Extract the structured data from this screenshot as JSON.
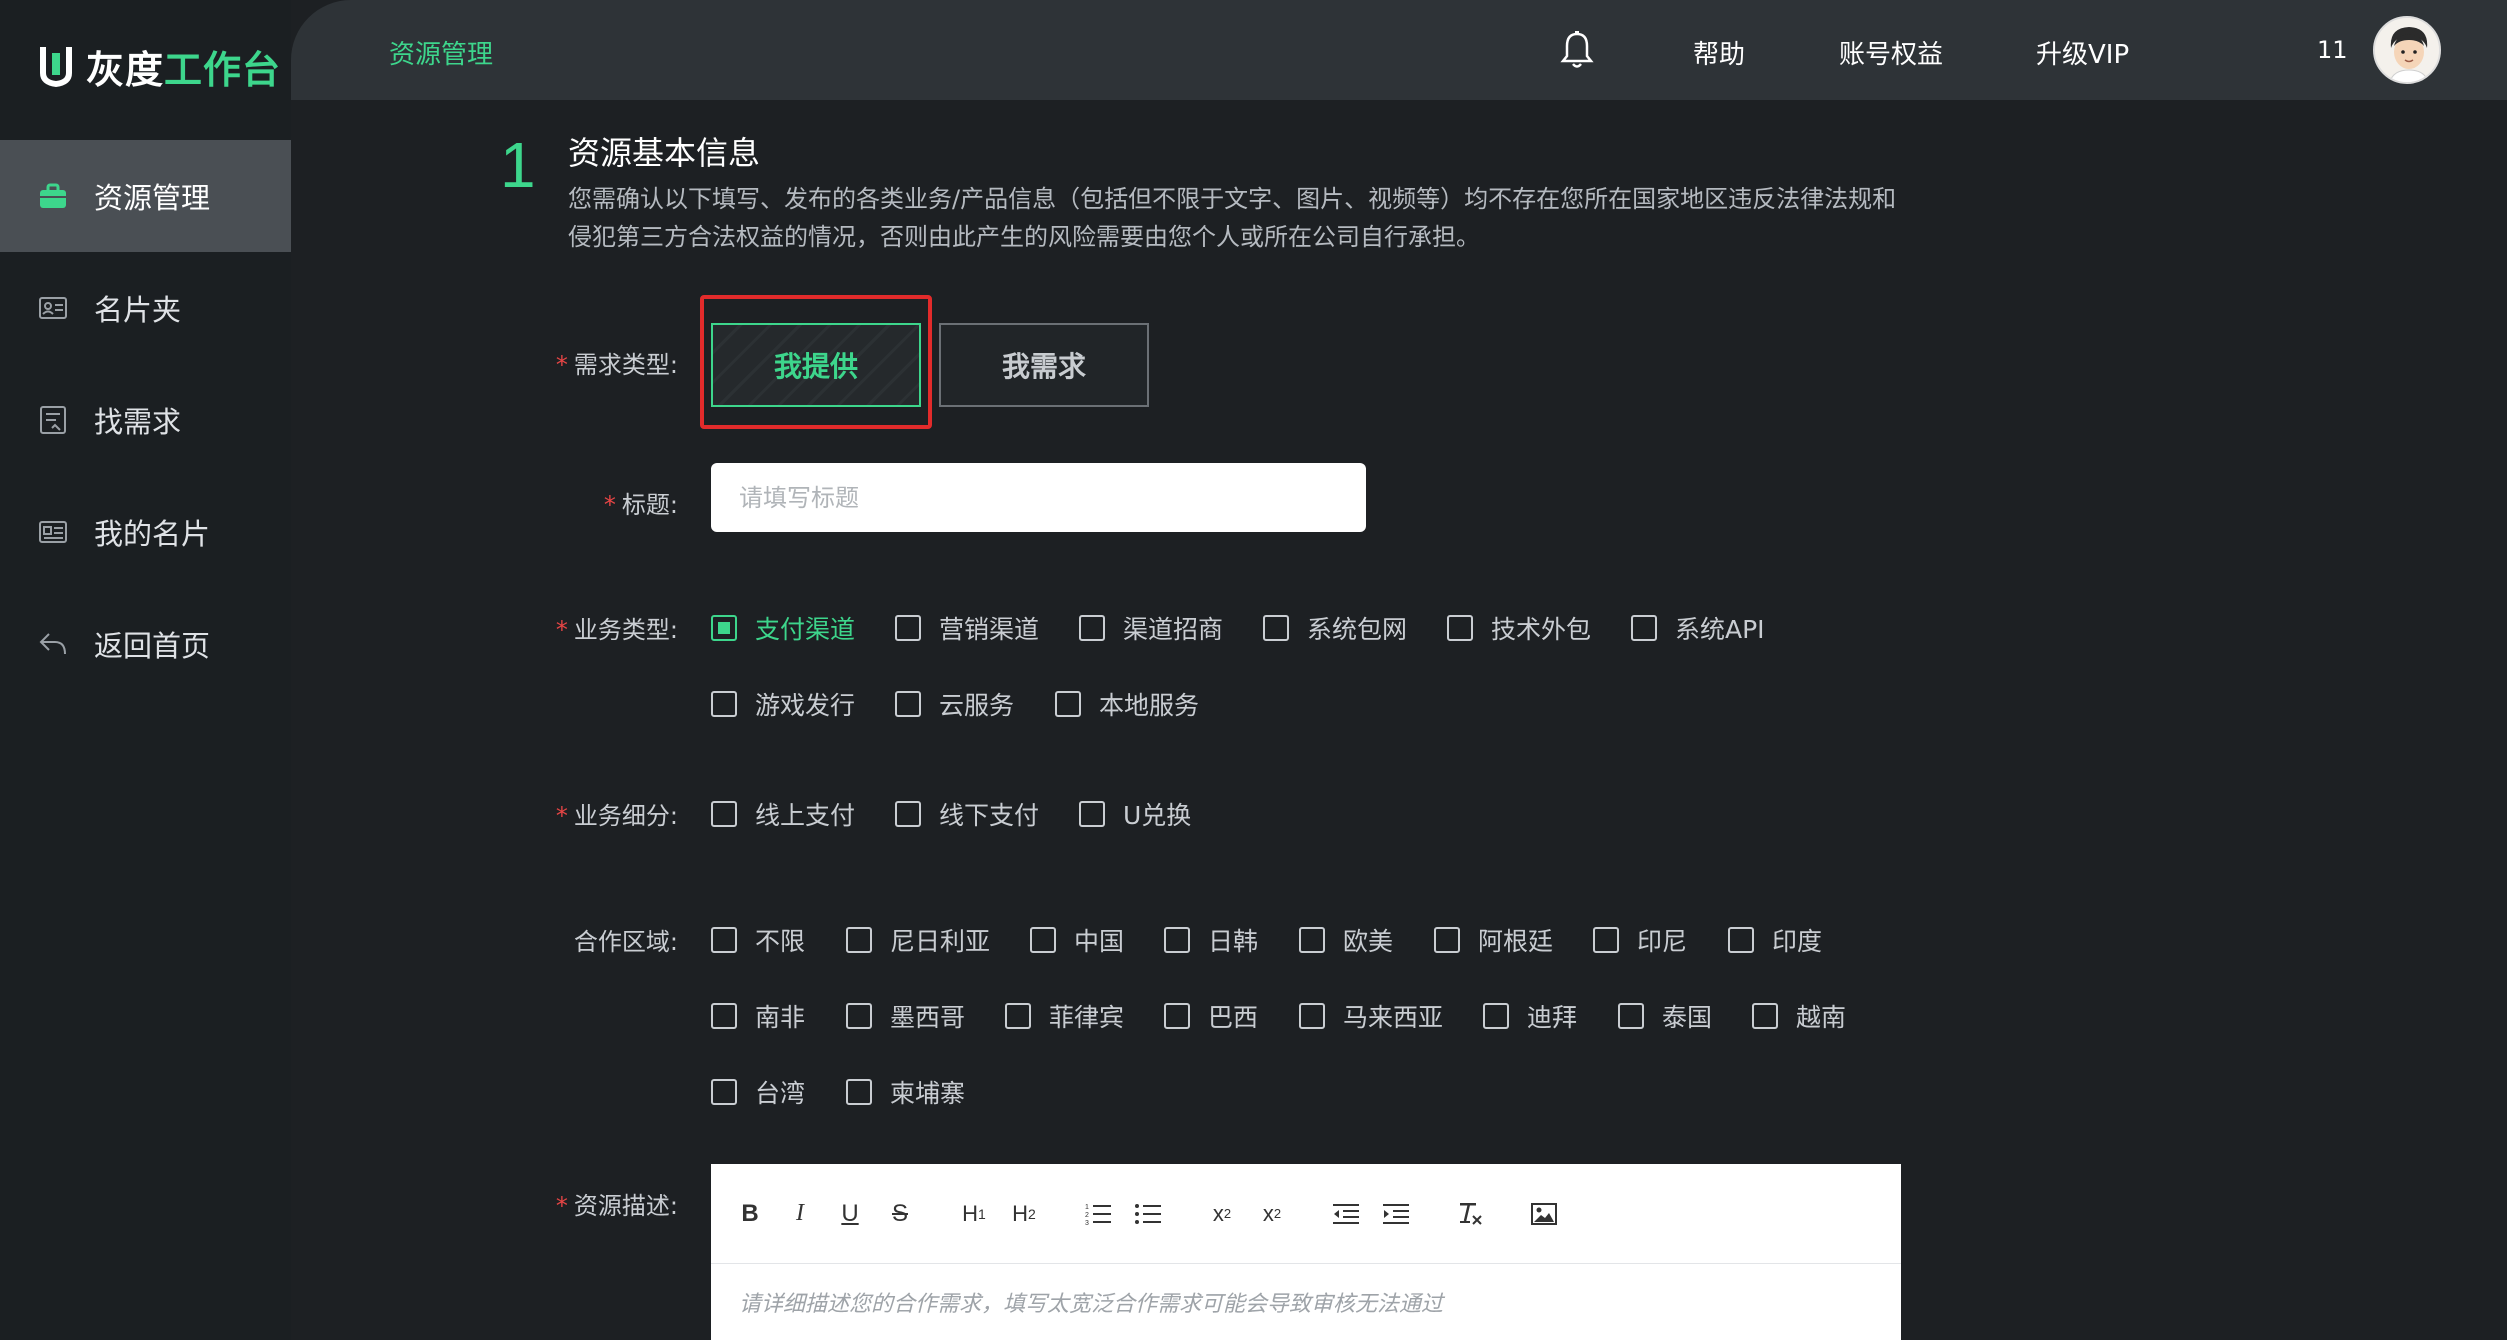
{
  "app": {
    "logo_white": "灰度",
    "logo_green": "工作台"
  },
  "sidebar": {
    "items": [
      {
        "label": "资源管理",
        "icon": "briefcase-icon",
        "active": true
      },
      {
        "label": "名片夹",
        "icon": "card-holder-icon"
      },
      {
        "label": "找需求",
        "icon": "demand-list-icon"
      },
      {
        "label": "我的名片",
        "icon": "id-card-icon"
      },
      {
        "label": "返回首页",
        "icon": "back-arrow-icon"
      }
    ]
  },
  "header": {
    "breadcrumb": "资源管理",
    "links": [
      "帮助",
      "账号权益",
      "升级VIP"
    ],
    "user_count": "11"
  },
  "section": {
    "step": "1",
    "title": "资源基本信息",
    "desc": "您需确认以下填写、发布的各类业务/产品信息（包括但不限于文字、图片、视频等）均不存在您所在国家地区违反法律法规和侵犯第三方合法权益的情况，否则由此产生的风险需要由您个人或所在公司自行承担。"
  },
  "form": {
    "demand_type_label": "需求类型:",
    "demand_types": [
      "我提供",
      "我需求"
    ],
    "demand_type_selected": "我提供",
    "title_label": "标题:",
    "title_placeholder": "请填写标题",
    "business_type_label": "业务类型:",
    "business_types": [
      "支付渠道",
      "营销渠道",
      "渠道招商",
      "系统包网",
      "技术外包",
      "系统API",
      "游戏发行",
      "云服务",
      "本地服务"
    ],
    "business_type_checked": [
      "支付渠道"
    ],
    "business_sub_label": "业务细分:",
    "business_subs": [
      "线上支付",
      "线下支付",
      "U兑换"
    ],
    "region_label": "合作区域:",
    "regions": [
      "不限",
      "尼日利亚",
      "中国",
      "日韩",
      "欧美",
      "阿根廷",
      "印尼",
      "印度",
      "南非",
      "墨西哥",
      "菲律宾",
      "巴西",
      "马来西亚",
      "迪拜",
      "泰国",
      "越南",
      "台湾",
      "柬埔寨"
    ],
    "desc_label": "资源描述:",
    "desc_placeholder": "请详细描述您的合作需求，填写太宽泛合作需求可能会导致审核无法通过"
  },
  "editor_toolbar": [
    "bold",
    "italic",
    "underline",
    "strike",
    "h1",
    "h2",
    "ordered-list",
    "bullet-list",
    "subscript",
    "superscript",
    "outdent",
    "indent",
    "clear-format",
    "image"
  ],
  "colors": {
    "accent": "#3dd68c",
    "required": "#e64545",
    "highlight_frame": "#e22b2b",
    "sidebar_active": "#4a4f54"
  }
}
